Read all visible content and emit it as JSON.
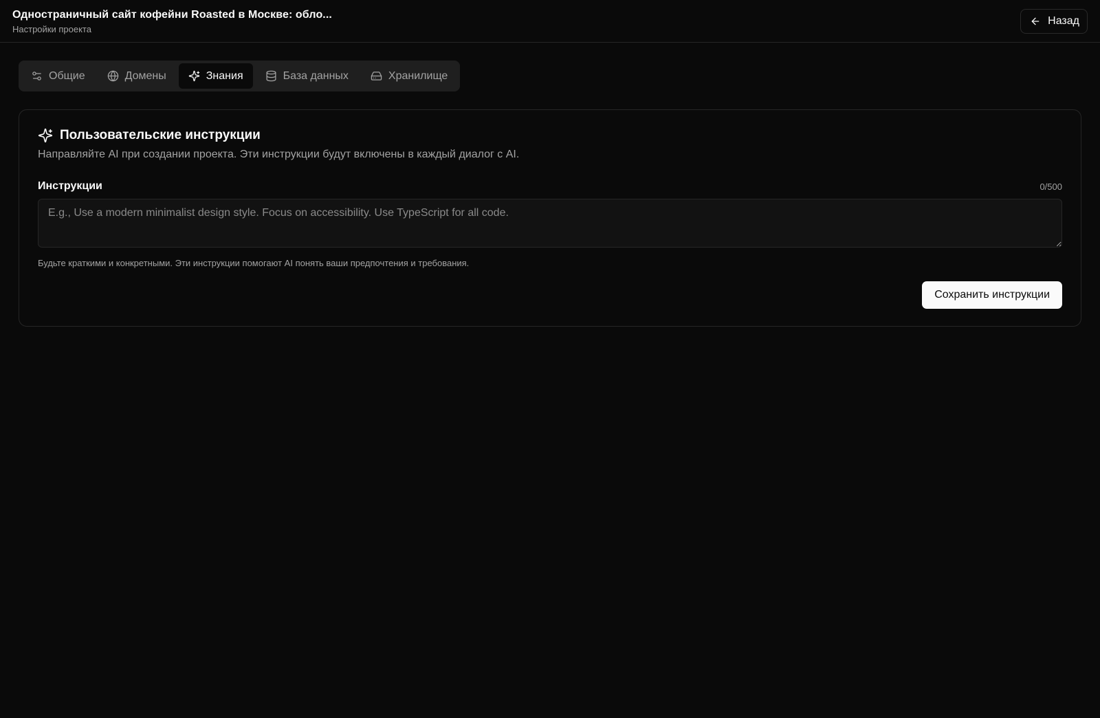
{
  "header": {
    "title": "Одностраничный сайт кофейни Roasted в Москве: обло...",
    "subtitle": "Настройки проекта",
    "back_label": "Назад",
    "back_icon": "arrow-left-icon"
  },
  "tabs": [
    {
      "label": "Общие",
      "icon": "sliders-icon",
      "active": false
    },
    {
      "label": "Домены",
      "icon": "globe-icon",
      "active": false
    },
    {
      "label": "Знания",
      "icon": "sparkles-icon",
      "active": true
    },
    {
      "label": "База данных",
      "icon": "database-icon",
      "active": false
    },
    {
      "label": "Хранилище",
      "icon": "hard-drive-icon",
      "active": false
    }
  ],
  "card": {
    "title": "Пользовательские инструкции",
    "title_icon": "sparkles-icon",
    "description": "Направляйте AI при создании проекта. Эти инструкции будут включены в каждый диалог с AI.",
    "field_label": "Инструкции",
    "char_count": "0/500",
    "textarea_value": "",
    "textarea_placeholder": "E.g., Use a modern minimalist design style. Focus on accessibility. Use TypeScript for all code.",
    "help_text": "Будьте краткими и конкретными. Эти инструкции помогают AI понять ваши предпочтения и требования.",
    "save_label": "Сохранить инструкции"
  },
  "colors": {
    "background": "#0a0a0a",
    "tabs_background": "#1f1f1f",
    "border": "#262626",
    "muted_text": "#a3a3a3",
    "primary_button": "#fafafa"
  }
}
